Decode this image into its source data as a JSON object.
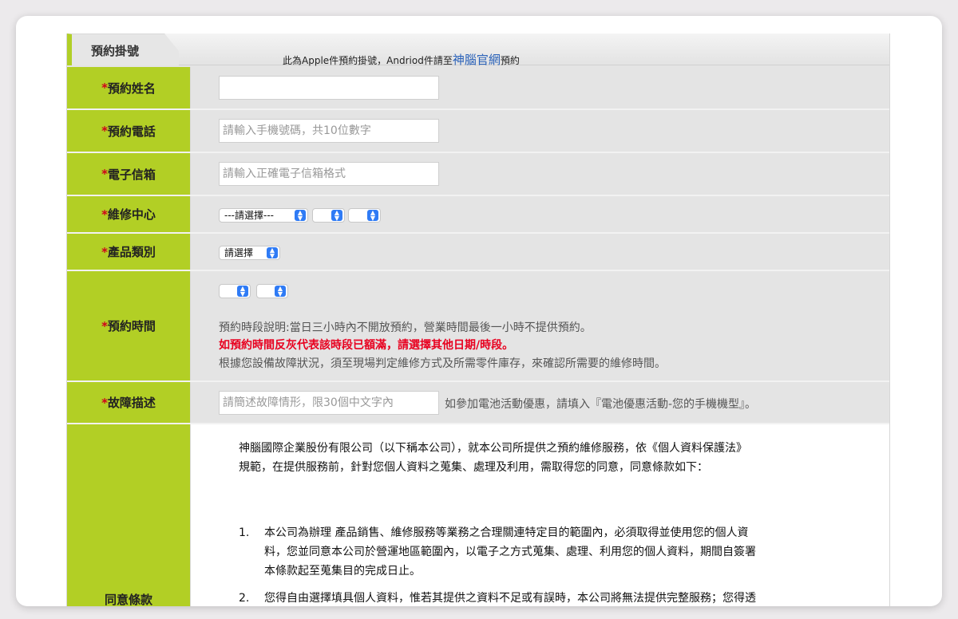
{
  "header": {
    "tab_title": "預約掛號",
    "notice_prefix": "此為Apple件預約掛號，Andriod件請至",
    "notice_link": "神腦官網",
    "notice_suffix": "預約"
  },
  "form": {
    "required_mark": "*",
    "name": {
      "label": "預約姓名",
      "value": "",
      "placeholder": ""
    },
    "phone": {
      "label": "預約電話",
      "placeholder": "請輸入手機號碼，共10位數字"
    },
    "email": {
      "label": "電子信箱",
      "placeholder": "請輸入正確電子信箱格式"
    },
    "center": {
      "label": "維修中心",
      "select1": "---請選擇---",
      "select2": "",
      "select3": ""
    },
    "category": {
      "label": "產品類別",
      "select": "請選擇"
    },
    "time": {
      "label": "預約時間",
      "select1": "",
      "select2": "",
      "note1": "預約時段說明:當日三小時內不開放預約，營業時間最後一小時不提供預約。",
      "note2": "如預約時間反灰代表該時段已額滿，請選擇其他日期/時段。",
      "note3": "根據您設備故障狀況，須至現場判定維修方式及所需零件庫存，來確認所需要的維修時間。"
    },
    "fault": {
      "label": "故障描述",
      "placeholder": "請簡述故障情形，限30個中文字內",
      "note": "如參加電池活動優惠，請填入『電池優惠活動-您的手機機型』。"
    },
    "consent": {
      "label": "同意條款",
      "intro_line1": "神腦國際企業股份有限公司（以下稱本公司），就本公司所提供之預約維修服務，依《個人資料保護法》",
      "intro_line2": "規範，在提供服務前，針對您個人資料之蒐集、處理及利用，需取得您的同意，同意條款如下：",
      "item1_num": "1.",
      "item1_line1": "本公司為辦理 產品銷售、維修服務等業務之合理關連特定目的範圍內，必須取得並使用您的個人資",
      "item1_line2": "料，您並同意本公司於營運地區範圍內，以電子之方式蒐集、處理、利用您的個人資料，期間自簽署",
      "item1_line3": "本條款起至蒐集目的完成日止。",
      "item2_num": "2.",
      "item2_line1": "您得自由選擇填具個人資料，惟若其提供之資料不足或有誤時，本公司將無法提供完整服務；您得透"
    }
  },
  "colors": {
    "label_bg": "#b2cf25",
    "required": "#d0021b",
    "link": "#2a62b9",
    "warning": "#e8001f",
    "select_arrow": "#2f7bf5"
  }
}
